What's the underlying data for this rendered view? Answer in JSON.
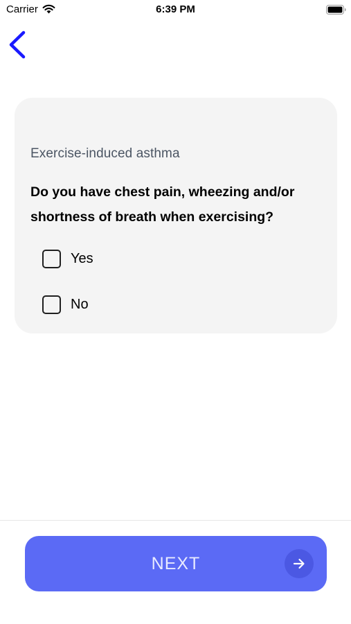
{
  "status_bar": {
    "carrier": "Carrier",
    "time": "6:39 PM",
    "wifi_icon": "wifi-icon",
    "battery_icon": "battery-icon"
  },
  "nav": {
    "back_icon": "chevron-left-icon"
  },
  "card": {
    "category": "Exercise-induced asthma",
    "question": "Do you have chest pain, wheezing and/or shortness of breath when exercising?",
    "options": [
      {
        "label": "Yes",
        "checked": false
      },
      {
        "label": "No",
        "checked": false
      }
    ]
  },
  "footer": {
    "next_label": "NEXT",
    "next_icon": "arrow-right-icon"
  },
  "colors": {
    "accent": "#5b6af5",
    "back_chevron": "#1a1aff",
    "card_background": "#f4f4f4",
    "category_text": "#4b5563"
  }
}
